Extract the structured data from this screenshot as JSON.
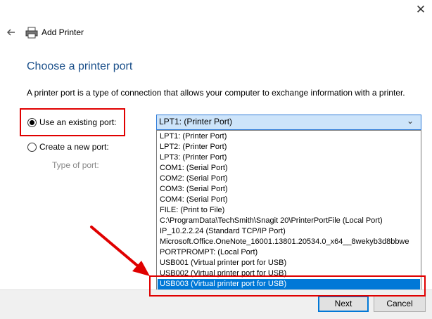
{
  "window": {
    "title": "Add Printer",
    "close_glyph": "✕"
  },
  "page": {
    "heading": "Choose a printer port",
    "description": "A printer port is a type of connection that allows your computer to exchange information with a printer."
  },
  "options": {
    "existing_label": "Use an existing port:",
    "new_label": "Create a new port:",
    "type_label": "Type of port:"
  },
  "port_select": {
    "value": "LPT1: (Printer Port)",
    "arrow_glyph": "⌄",
    "items": [
      "LPT1: (Printer Port)",
      "LPT2: (Printer Port)",
      "LPT3: (Printer Port)",
      "COM1: (Serial Port)",
      "COM2: (Serial Port)",
      "COM3: (Serial Port)",
      "COM4: (Serial Port)",
      "FILE: (Print to File)",
      "C:\\ProgramData\\TechSmith\\Snagit 20\\PrinterPortFile (Local Port)",
      "IP_10.2.2.24 (Standard TCP/IP Port)",
      "Microsoft.Office.OneNote_16001.13801.20534.0_x64__8wekyb3d8bbwe",
      "PORTPROMPT: (Local Port)",
      "USB001 (Virtual printer port for USB)",
      "USB002 (Virtual printer port for USB)",
      "USB003 (Virtual printer port for USB)"
    ],
    "selected_index": 14
  },
  "buttons": {
    "next": "Next",
    "cancel": "Cancel"
  },
  "colors": {
    "heading": "#1a4f8a",
    "highlight": "#0078d7",
    "annotation": "#e00000"
  },
  "icons": {
    "back": "back-arrow-icon",
    "printer": "printer-icon",
    "close": "close-icon",
    "chevron": "chevron-down-icon"
  }
}
